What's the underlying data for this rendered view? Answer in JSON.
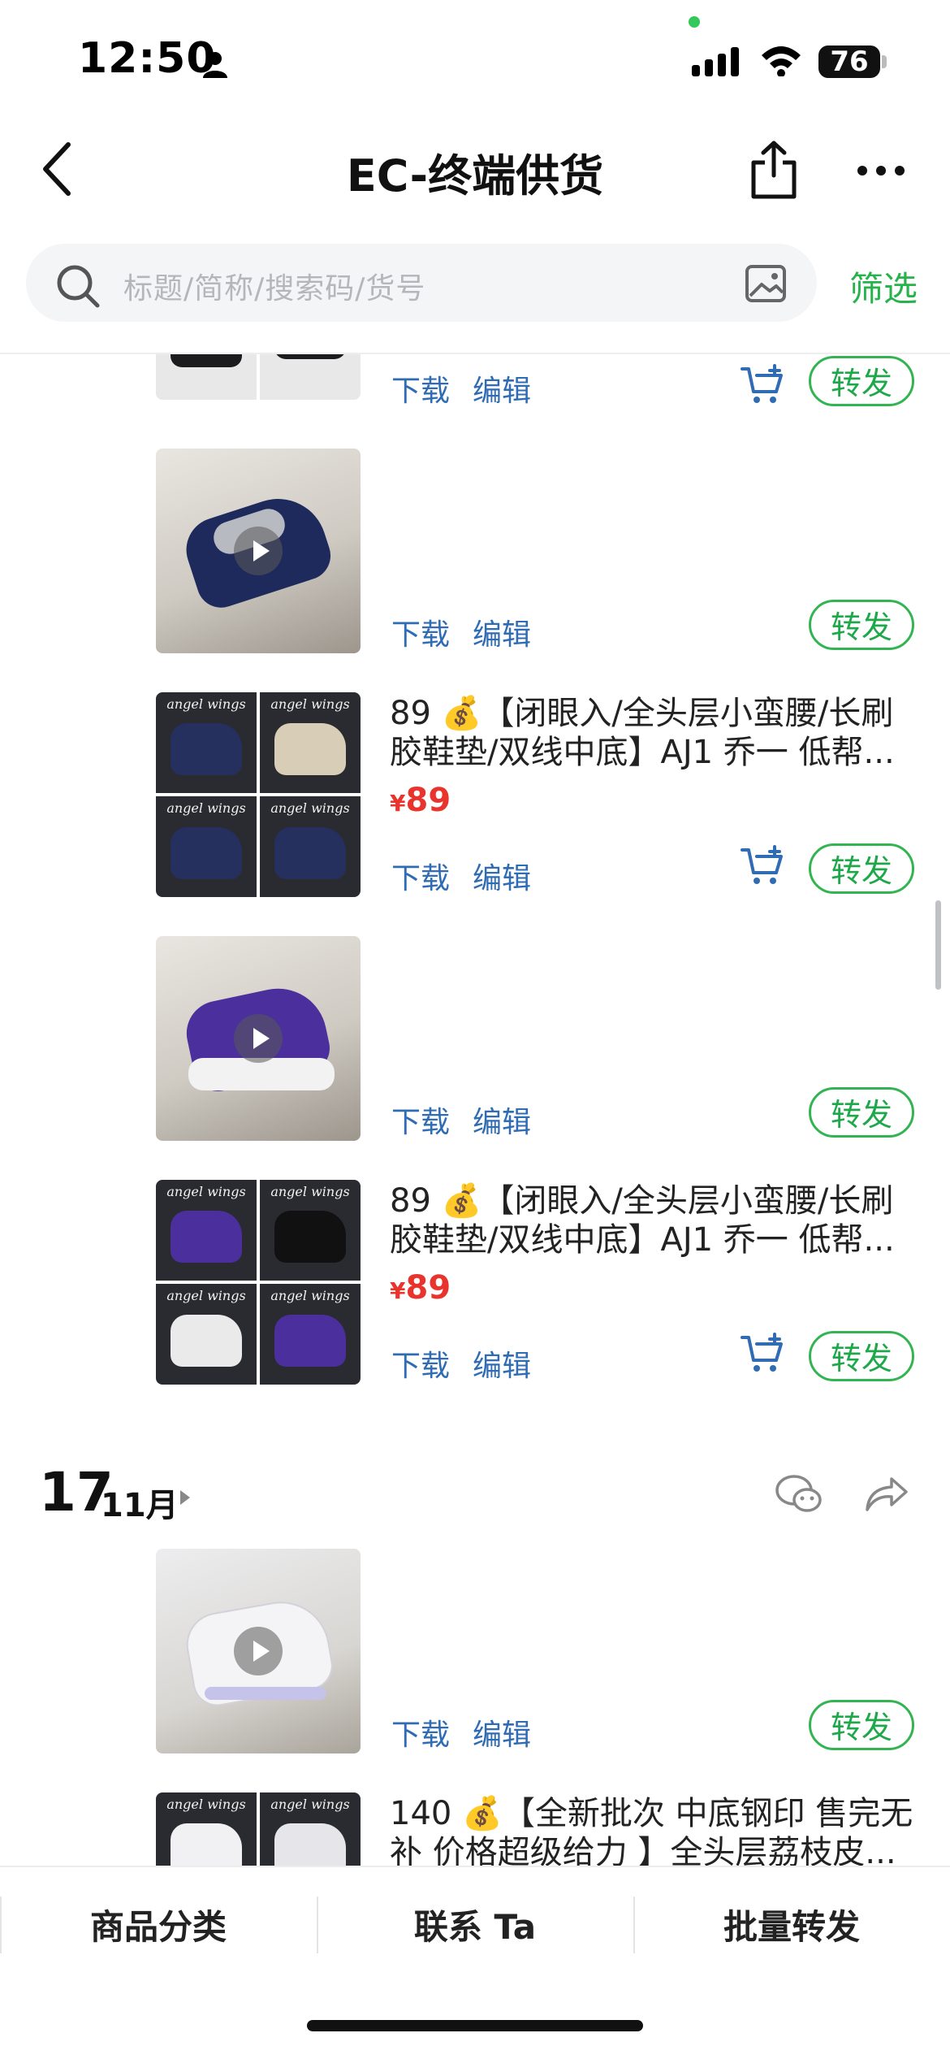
{
  "status_bar": {
    "time": "12:50",
    "battery": "76"
  },
  "nav": {
    "title": "EC-终端供货"
  },
  "search": {
    "placeholder": "标题/简称/搜索码/货号",
    "filter_label": "筛选"
  },
  "common": {
    "download": "下载",
    "edit": "编辑",
    "forward": "转发",
    "currency": "¥"
  },
  "items": [
    {
      "type": "partial",
      "thumb_colors": [
        "#1c1c1e",
        "#f2f2f2"
      ]
    },
    {
      "type": "video",
      "shoe_color": "#1f2a5c"
    },
    {
      "type": "product",
      "desc": "89 💰【闭眼入/全头层小蛮腰/长刷胶鞋垫/双线中底】AJ1 乔一 低帮...",
      "price": "89",
      "shoe_color": "#25305f",
      "watermark": "angel wings"
    },
    {
      "type": "video",
      "shoe_color": "#4b2f9c"
    },
    {
      "type": "product",
      "desc": "89 💰【闭眼入/全头层小蛮腰/长刷胶鞋垫/双线中底】AJ1 乔一 低帮...",
      "price": "89",
      "shoe_color": "#4b2f9c",
      "watermark": "angel wings"
    },
    {
      "type": "video",
      "shoe_color": "#f1f1f3"
    },
    {
      "type": "product",
      "desc": "140 💰【全新批次 中底钢印 售完无补 价格超级给力 】全头层荔枝皮...",
      "shoe_color": "#f1f1f3",
      "watermark": "angel wings"
    }
  ],
  "date_header": {
    "day": "17",
    "month": "11月"
  },
  "tabbar": {
    "tabs": [
      "商品分类",
      "联系 Ta",
      "批量转发"
    ]
  },
  "colors": {
    "accent_green": "#26b34a",
    "link_blue": "#2f6cb3",
    "price_red": "#e8342c"
  }
}
